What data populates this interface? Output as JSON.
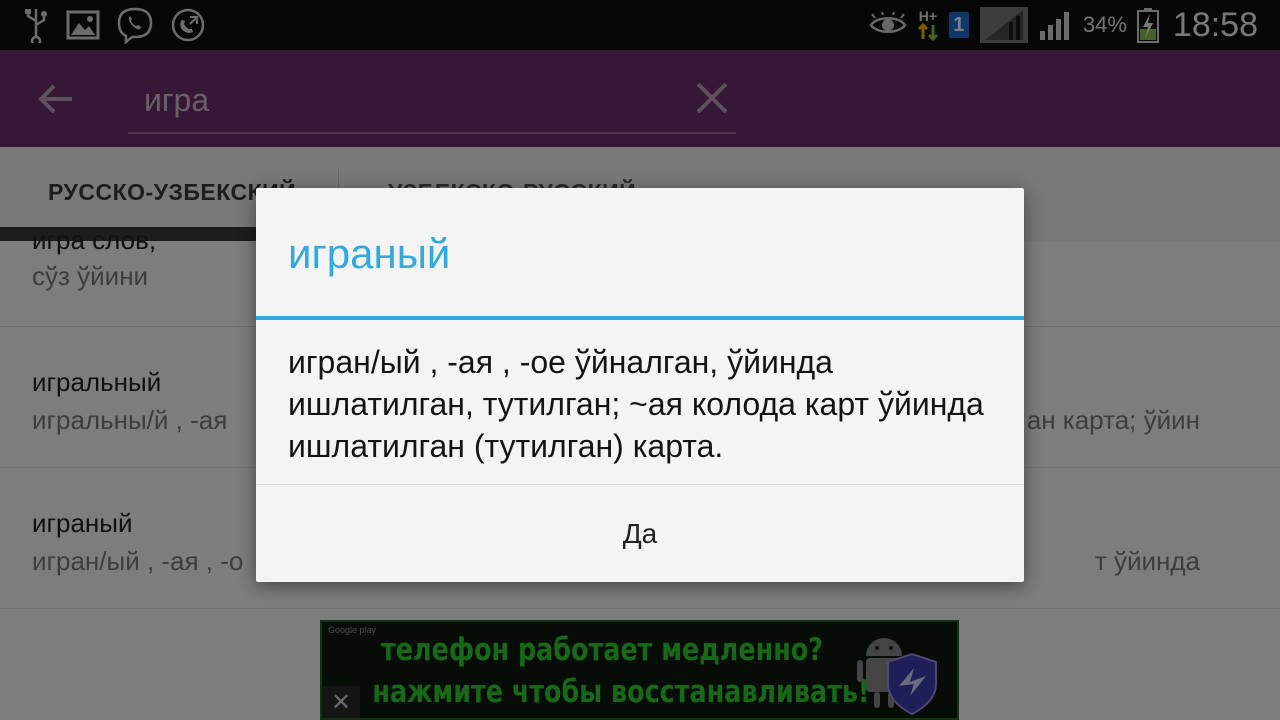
{
  "status_bar": {
    "left_icons": [
      "usb-icon",
      "image-icon",
      "viber-icon",
      "call-icon"
    ],
    "right_icons": [
      "eye-icon",
      "network-hplus-icon",
      "sim-1-icon",
      "signal-icon",
      "signal-icon-2",
      "battery-charging-icon"
    ],
    "network_label": "H+",
    "sim_label": "1",
    "battery_percent": "34%",
    "time": "18:58"
  },
  "toolbar": {
    "back_icon": "arrow-back-icon",
    "search_value": "игра",
    "clear_icon": "close-icon",
    "color": "#6c2e6b"
  },
  "tabs": {
    "items": [
      {
        "label": "РУССКО-УЗБЕКСКИЙ",
        "selected": true
      },
      {
        "label": "УЗБЕКСКО-РУССКИЙ",
        "selected": false
      }
    ]
  },
  "list": {
    "items": [
      {
        "term": "игра слов,",
        "definition": "сўз ўйини",
        "definition_tail": ""
      },
      {
        "term": "игральный",
        "definition": "игральны/й , -ая",
        "definition_tail": "ан карта; ўйин"
      },
      {
        "term": "играный",
        "definition": "игран/ый , -ая , -о",
        "definition_tail": "т ўйинда"
      }
    ]
  },
  "ad": {
    "gplay_label": "Google play",
    "line1": "телефон работает медленно?",
    "line2": "нажмите чтобы восстанавливать!",
    "close_label": "✕",
    "text_color": "#2fd22f"
  },
  "dialog": {
    "title": "играный",
    "body": "игран/ый , -ая , -ое ўйналган, ўйинда ишлатилган, тутилган; ~ая колода карт ўйинда ишлатилган (тутилган) карта.",
    "button_label": "Да",
    "accent": "#33aadf"
  }
}
